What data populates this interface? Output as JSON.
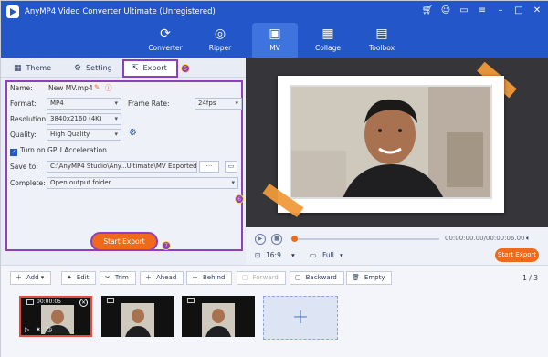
{
  "app": {
    "title": "AnyMP4 Video Converter Ultimate (Unregistered)"
  },
  "window_controls": [
    "cart-icon",
    "user-icon",
    "chat-icon",
    "menu-icon",
    "minimize-icon",
    "maximize-icon",
    "close-icon"
  ],
  "tabs": [
    {
      "label": "Converter",
      "icon": "converter-icon"
    },
    {
      "label": "Ripper",
      "icon": "ripper-icon"
    },
    {
      "label": "MV",
      "icon": "mv-icon",
      "active": true
    },
    {
      "label": "Collage",
      "icon": "collage-icon"
    },
    {
      "label": "Toolbox",
      "icon": "toolbox-icon"
    }
  ],
  "subtabs": {
    "theme": "Theme",
    "setting": "Setting",
    "export": "Export"
  },
  "export_settings": {
    "name_label": "Name:",
    "name_value": "New MV.mp4",
    "format_label": "Format:",
    "format_value": "MP4",
    "framerate_label": "Frame Rate:",
    "framerate_value": "24fps",
    "resolution_label": "Resolution:",
    "resolution_value": "3840x2160 (4K)",
    "quality_label": "Quality:",
    "quality_value": "High Quality",
    "gpu_label": "Turn on GPU Acceleration",
    "saveto_label": "Save to:",
    "saveto_value": "C:\\AnyMP4 Studio\\Any...Ultimate\\MV Exported",
    "browse_label": "···",
    "complete_label": "Complete:",
    "complete_value": "Open output folder"
  },
  "start_export": "Start Export",
  "badges": {
    "b1": "5",
    "b2": "6",
    "b3": "7"
  },
  "player": {
    "timecode": "00:00:00.00/00:00:06.00",
    "aspect": "16:9",
    "zoom": "Full",
    "start_export": "Start Export"
  },
  "timeline_toolbar": {
    "add": "Add",
    "edit": "Edit",
    "trim": "Trim",
    "ahead": "Ahead",
    "behind": "Behind",
    "forward": "Forward",
    "backward": "Backward",
    "empty": "Empty",
    "pager": "1 / 3"
  },
  "clips": [
    {
      "time": "00:00:05"
    }
  ],
  "colors": {
    "brand": "#2356c8",
    "accent": "#f06a1a",
    "highlight": "#8c3fbf"
  }
}
